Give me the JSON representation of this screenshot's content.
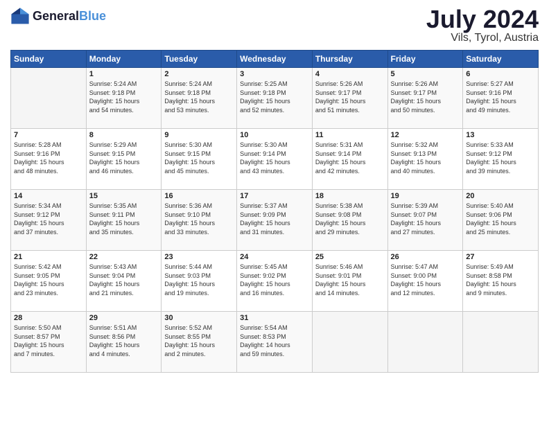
{
  "logo": {
    "line1": "General",
    "line2": "Blue"
  },
  "title": "July 2024",
  "location": "Vils, Tyrol, Austria",
  "days_of_week": [
    "Sunday",
    "Monday",
    "Tuesday",
    "Wednesday",
    "Thursday",
    "Friday",
    "Saturday"
  ],
  "weeks": [
    [
      {
        "day": "",
        "info": ""
      },
      {
        "day": "1",
        "info": "Sunrise: 5:24 AM\nSunset: 9:18 PM\nDaylight: 15 hours\nand 54 minutes."
      },
      {
        "day": "2",
        "info": "Sunrise: 5:24 AM\nSunset: 9:18 PM\nDaylight: 15 hours\nand 53 minutes."
      },
      {
        "day": "3",
        "info": "Sunrise: 5:25 AM\nSunset: 9:18 PM\nDaylight: 15 hours\nand 52 minutes."
      },
      {
        "day": "4",
        "info": "Sunrise: 5:26 AM\nSunset: 9:17 PM\nDaylight: 15 hours\nand 51 minutes."
      },
      {
        "day": "5",
        "info": "Sunrise: 5:26 AM\nSunset: 9:17 PM\nDaylight: 15 hours\nand 50 minutes."
      },
      {
        "day": "6",
        "info": "Sunrise: 5:27 AM\nSunset: 9:16 PM\nDaylight: 15 hours\nand 49 minutes."
      }
    ],
    [
      {
        "day": "7",
        "info": "Sunrise: 5:28 AM\nSunset: 9:16 PM\nDaylight: 15 hours\nand 48 minutes."
      },
      {
        "day": "8",
        "info": "Sunrise: 5:29 AM\nSunset: 9:15 PM\nDaylight: 15 hours\nand 46 minutes."
      },
      {
        "day": "9",
        "info": "Sunrise: 5:30 AM\nSunset: 9:15 PM\nDaylight: 15 hours\nand 45 minutes."
      },
      {
        "day": "10",
        "info": "Sunrise: 5:30 AM\nSunset: 9:14 PM\nDaylight: 15 hours\nand 43 minutes."
      },
      {
        "day": "11",
        "info": "Sunrise: 5:31 AM\nSunset: 9:14 PM\nDaylight: 15 hours\nand 42 minutes."
      },
      {
        "day": "12",
        "info": "Sunrise: 5:32 AM\nSunset: 9:13 PM\nDaylight: 15 hours\nand 40 minutes."
      },
      {
        "day": "13",
        "info": "Sunrise: 5:33 AM\nSunset: 9:12 PM\nDaylight: 15 hours\nand 39 minutes."
      }
    ],
    [
      {
        "day": "14",
        "info": "Sunrise: 5:34 AM\nSunset: 9:12 PM\nDaylight: 15 hours\nand 37 minutes."
      },
      {
        "day": "15",
        "info": "Sunrise: 5:35 AM\nSunset: 9:11 PM\nDaylight: 15 hours\nand 35 minutes."
      },
      {
        "day": "16",
        "info": "Sunrise: 5:36 AM\nSunset: 9:10 PM\nDaylight: 15 hours\nand 33 minutes."
      },
      {
        "day": "17",
        "info": "Sunrise: 5:37 AM\nSunset: 9:09 PM\nDaylight: 15 hours\nand 31 minutes."
      },
      {
        "day": "18",
        "info": "Sunrise: 5:38 AM\nSunset: 9:08 PM\nDaylight: 15 hours\nand 29 minutes."
      },
      {
        "day": "19",
        "info": "Sunrise: 5:39 AM\nSunset: 9:07 PM\nDaylight: 15 hours\nand 27 minutes."
      },
      {
        "day": "20",
        "info": "Sunrise: 5:40 AM\nSunset: 9:06 PM\nDaylight: 15 hours\nand 25 minutes."
      }
    ],
    [
      {
        "day": "21",
        "info": "Sunrise: 5:42 AM\nSunset: 9:05 PM\nDaylight: 15 hours\nand 23 minutes."
      },
      {
        "day": "22",
        "info": "Sunrise: 5:43 AM\nSunset: 9:04 PM\nDaylight: 15 hours\nand 21 minutes."
      },
      {
        "day": "23",
        "info": "Sunrise: 5:44 AM\nSunset: 9:03 PM\nDaylight: 15 hours\nand 19 minutes."
      },
      {
        "day": "24",
        "info": "Sunrise: 5:45 AM\nSunset: 9:02 PM\nDaylight: 15 hours\nand 16 minutes."
      },
      {
        "day": "25",
        "info": "Sunrise: 5:46 AM\nSunset: 9:01 PM\nDaylight: 15 hours\nand 14 minutes."
      },
      {
        "day": "26",
        "info": "Sunrise: 5:47 AM\nSunset: 9:00 PM\nDaylight: 15 hours\nand 12 minutes."
      },
      {
        "day": "27",
        "info": "Sunrise: 5:49 AM\nSunset: 8:58 PM\nDaylight: 15 hours\nand 9 minutes."
      }
    ],
    [
      {
        "day": "28",
        "info": "Sunrise: 5:50 AM\nSunset: 8:57 PM\nDaylight: 15 hours\nand 7 minutes."
      },
      {
        "day": "29",
        "info": "Sunrise: 5:51 AM\nSunset: 8:56 PM\nDaylight: 15 hours\nand 4 minutes."
      },
      {
        "day": "30",
        "info": "Sunrise: 5:52 AM\nSunset: 8:55 PM\nDaylight: 15 hours\nand 2 minutes."
      },
      {
        "day": "31",
        "info": "Sunrise: 5:54 AM\nSunset: 8:53 PM\nDaylight: 14 hours\nand 59 minutes."
      },
      {
        "day": "",
        "info": ""
      },
      {
        "day": "",
        "info": ""
      },
      {
        "day": "",
        "info": ""
      }
    ]
  ]
}
